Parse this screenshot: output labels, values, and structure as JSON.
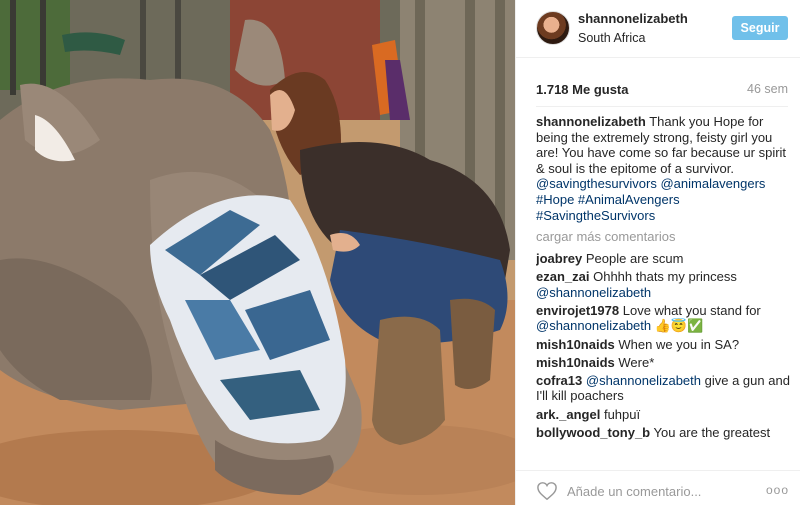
{
  "post": {
    "username": "shannonelizabeth",
    "location": "South Africa",
    "follow_label": "Seguir",
    "likes": "1.718 Me gusta",
    "time": "46 sem"
  },
  "caption": {
    "user": "shannonelizabeth",
    "text": "Thank you Hope for being the extremely strong, feisty girl you are! You have come so far because ur spirit & soul is the epitome of a survivor.",
    "tags": "@savingthesurvivors @animalavengers #Hope #AnimalAvengers #SavingtheSurvivors"
  },
  "load_more": "cargar más comentarios",
  "comments": [
    {
      "user": "joabrey",
      "text": "People are scum",
      "mention": ""
    },
    {
      "user": "ezan_zai",
      "text": "Ohhhh thats my princess",
      "mention": "@shannonelizabeth"
    },
    {
      "user": "envirojet1978",
      "text": "Love what you stand for",
      "mention": "@shannonelizabeth 👍😇✅"
    },
    {
      "user": "mish10naids",
      "text": "When we you in SA?",
      "mention": ""
    },
    {
      "user": "mish10naids",
      "text": "Were*",
      "mention": ""
    },
    {
      "user": "cofra13",
      "text": "give a gun and I'll kill poachers",
      "mention": "@shannonelizabeth"
    },
    {
      "user": "ark._angel",
      "text": "fuhpuï",
      "mention": ""
    },
    {
      "user": "bollywood_tony_b",
      "text": "You are the greatest",
      "mention": ""
    }
  ],
  "footer": {
    "add_comment_placeholder": "Añade un comentario...",
    "more_label": "ooo"
  },
  "colors": {
    "follow_button": "#70c0ea",
    "mention": "#003569",
    "muted": "#999999"
  }
}
